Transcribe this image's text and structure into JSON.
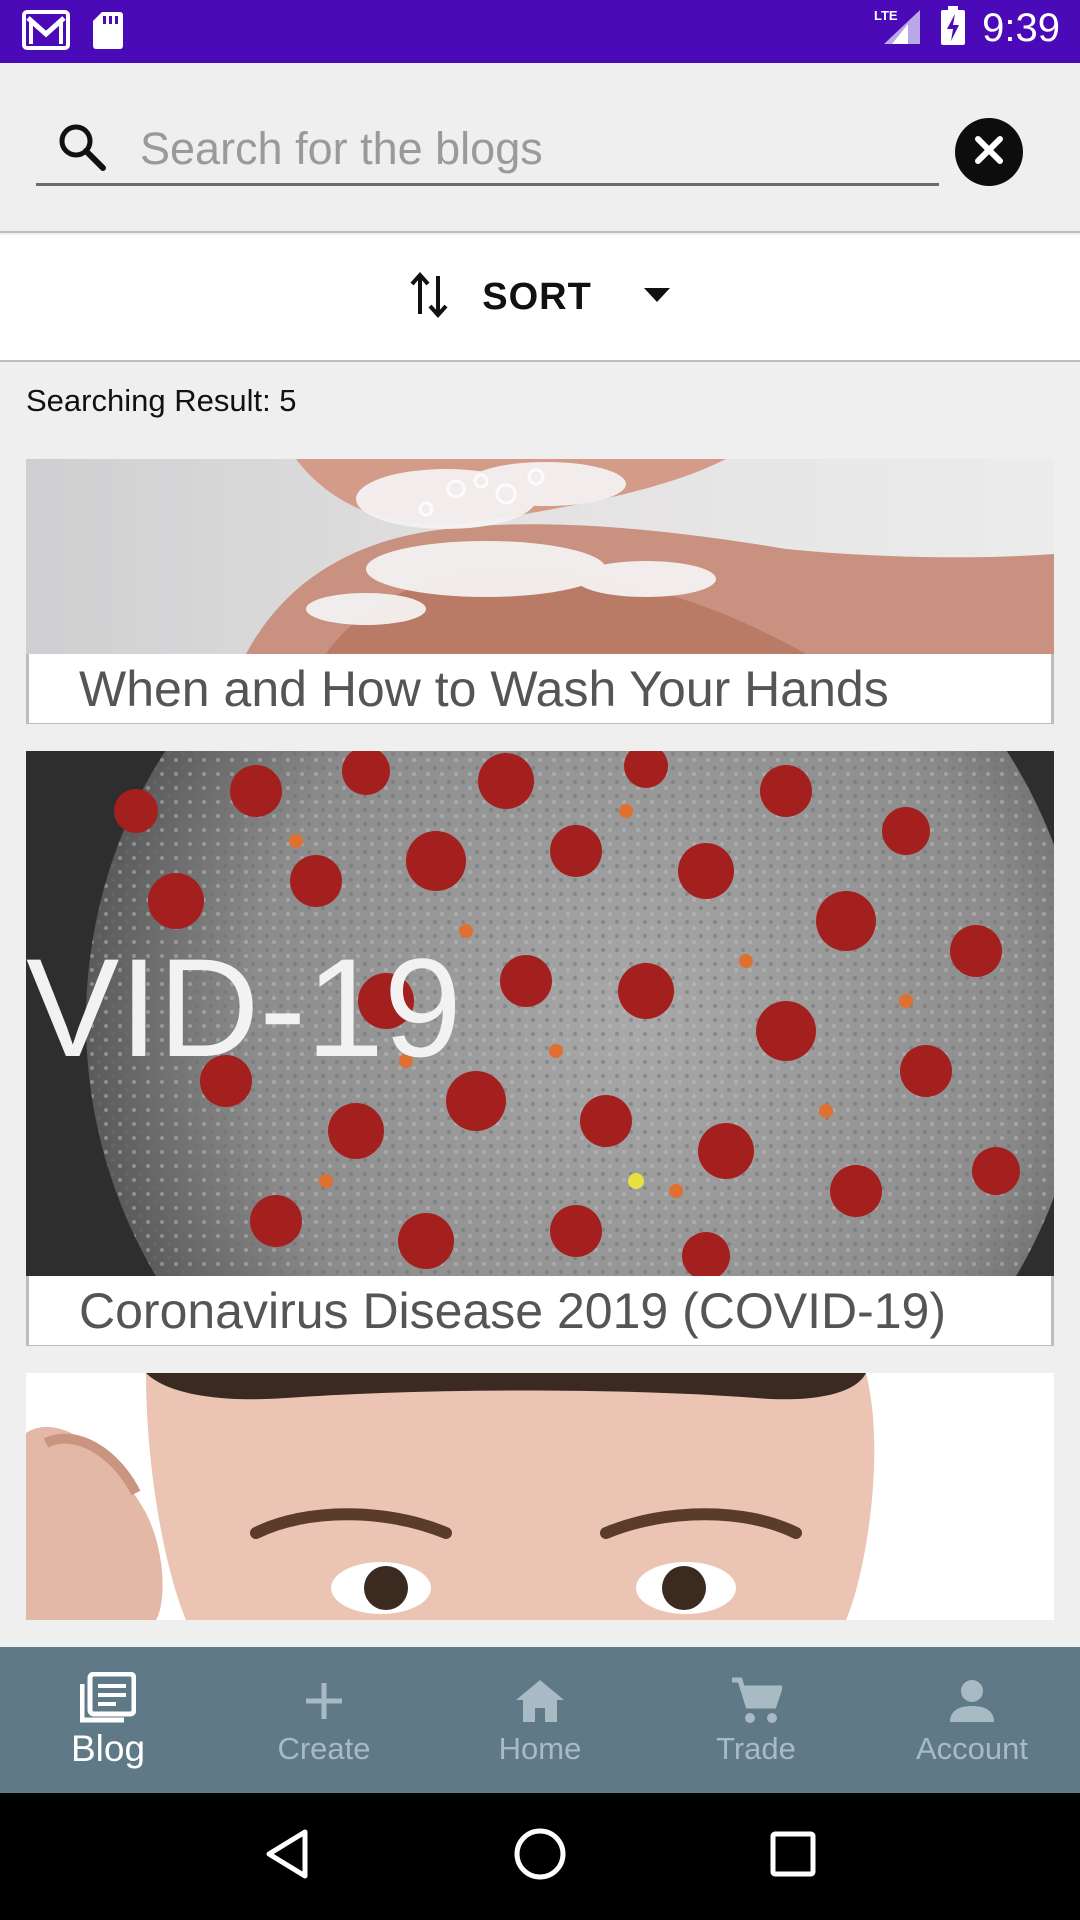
{
  "status_bar": {
    "time": "9:39",
    "network": "LTE",
    "icons": [
      "gmail-icon",
      "sd-card-icon",
      "signal-icon",
      "battery-charging-icon"
    ]
  },
  "search": {
    "placeholder": "Search for the blogs",
    "value": ""
  },
  "sort": {
    "label": "SORT"
  },
  "results": {
    "count_text": "Searching Result: 5"
  },
  "cards": [
    {
      "title": "When and How to Wash Your Hands",
      "image": "hand-washing-photo"
    },
    {
      "title": "Coronavirus Disease 2019 (COVID-19)",
      "image": "coronavirus-photo",
      "image_text": "VID-19"
    },
    {
      "title": "",
      "image": "face-closeup-photo"
    }
  ],
  "bottom_nav": {
    "items": [
      {
        "label": "Blog",
        "icon": "blog-icon",
        "active": true
      },
      {
        "label": "Create",
        "icon": "plus-icon",
        "active": false
      },
      {
        "label": "Home",
        "icon": "home-icon",
        "active": false
      },
      {
        "label": "Trade",
        "icon": "cart-icon",
        "active": false
      },
      {
        "label": "Account",
        "icon": "person-icon",
        "active": false
      }
    ]
  },
  "colors": {
    "status_bar": "#4a0ab8",
    "bottom_nav": "#5f7987",
    "nav_active": "#ffffff",
    "nav_inactive": "#a8bac4"
  }
}
